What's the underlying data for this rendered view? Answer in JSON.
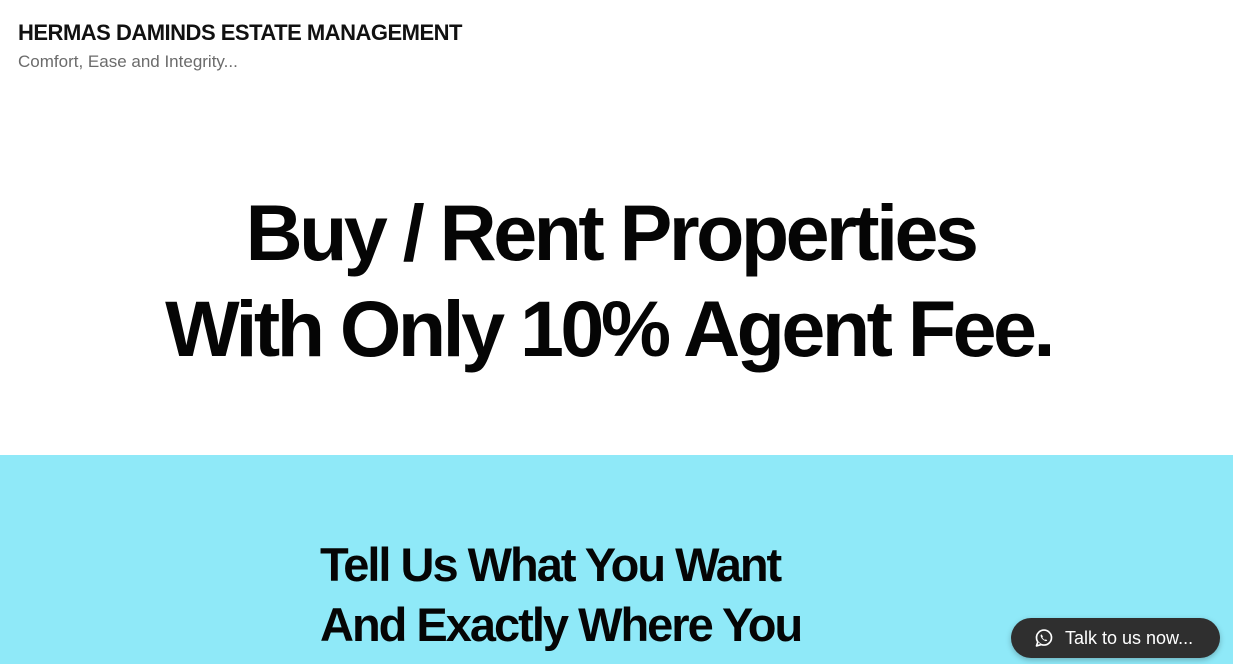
{
  "header": {
    "site_title": "HERMAS DAMINDS ESTATE MANAGEMENT",
    "tagline": "Comfort, Ease and Integrity..."
  },
  "hero": {
    "line1": "Buy / Rent Properties",
    "line2": "With Only 10% Agent Fee."
  },
  "section": {
    "background_color": "#8fe9f8",
    "heading_line1": "Tell Us What You Want",
    "heading_line2": "And Exactly Where You"
  },
  "chat_widget": {
    "label": "Talk to us now...",
    "icon": "whatsapp-icon",
    "background_color": "#2f2f2f"
  }
}
